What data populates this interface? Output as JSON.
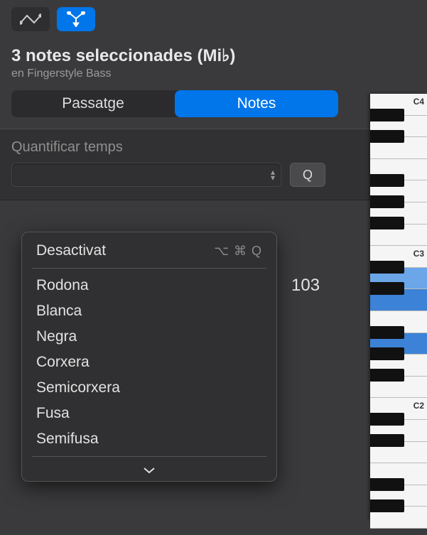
{
  "toolbar": {
    "automation_icon": "automation-curve-icon",
    "merge_icon": "merge-tool-icon"
  },
  "header": {
    "title": "3 notes seleccionades (Mi♭)",
    "subtitle": "en Fingerstyle Bass"
  },
  "segmented": {
    "left": "Passatge",
    "right": "Notes",
    "active": "right"
  },
  "quantize": {
    "label": "Quantificar temps",
    "selected": "",
    "button": "Q"
  },
  "menu": {
    "top_item": {
      "label": "Desactivat",
      "shortcut": "⌥ ⌘ Q"
    },
    "items": [
      "Rodona",
      "Blanca",
      "Negra",
      "Corxera",
      "Semicorxera",
      "Fusa",
      "Semifusa"
    ]
  },
  "readout_value": "103",
  "piano": {
    "labels": [
      "C4",
      "C3",
      "C2"
    ]
  }
}
